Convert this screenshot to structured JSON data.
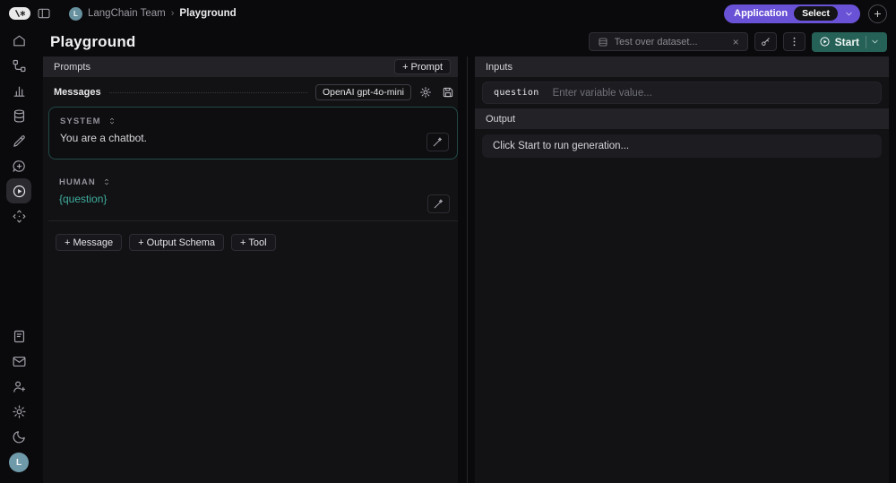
{
  "colors": {
    "accent_purple": "#6a52d6",
    "start_button_teal": "#266158",
    "variable_teal": "#3fae9d",
    "panel_bg": "#121215",
    "section_bar_bg": "#222227",
    "system_card_border": "rgba(64,172,154,0.38)"
  },
  "header": {
    "logo": "langsmith-logo",
    "breadcrumb": {
      "avatar_letter": "L",
      "team": "LangChain Team",
      "separator": "›",
      "page": "Playground"
    },
    "application_label": "Application",
    "application_value": "Select",
    "new_button_glyph": "+"
  },
  "toolbar": {
    "page_title": "Playground",
    "dataset_input": {
      "placeholder": "Test over dataset...",
      "clear_glyph": "×"
    },
    "start_label": "Start"
  },
  "sidebar": {
    "top_icons": [
      "home",
      "tracing-projects",
      "monitoring",
      "datasets",
      "annotation-queues",
      "prompts",
      "playground",
      "deployments"
    ],
    "active_item": "playground",
    "bottom_icons": [
      "docs",
      "mail",
      "invite-user",
      "settings",
      "theme-moon"
    ],
    "avatar_letter": "L"
  },
  "left_panel": {
    "prompts_header": "Prompts",
    "add_prompt_label": "+ Prompt",
    "messages_label": "Messages",
    "model_label": "OpenAI gpt-4o-mini",
    "messages": [
      {
        "role": "SYSTEM",
        "content": "You are a chatbot."
      },
      {
        "role": "HUMAN",
        "content": "{question}"
      }
    ],
    "add_buttons": [
      "+ Message",
      "+ Output Schema",
      "+ Tool"
    ]
  },
  "right_panel": {
    "inputs_header": "Inputs",
    "variable_name": "question",
    "variable_placeholder": "Enter variable value...",
    "output_header": "Output",
    "output_placeholder": "Click Start to run generation..."
  }
}
